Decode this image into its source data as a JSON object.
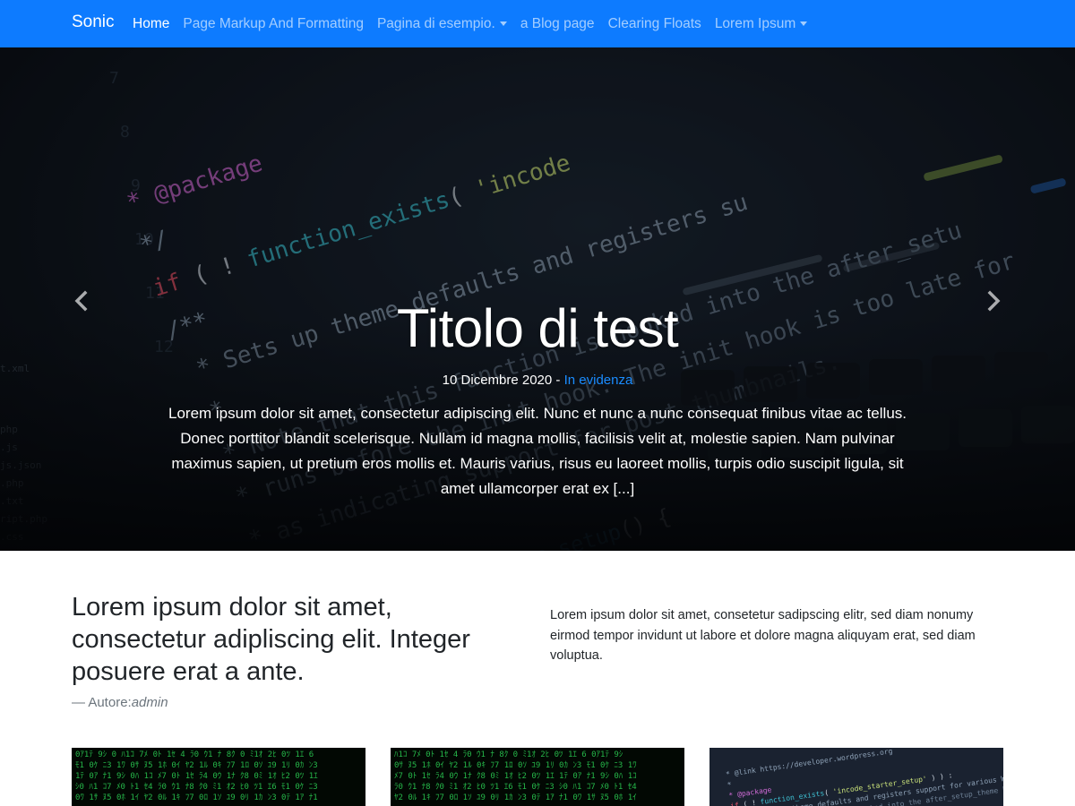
{
  "navbar": {
    "brand": "Sonic",
    "items": [
      {
        "label": "Home",
        "active": true,
        "dropdown": false
      },
      {
        "label": "Page Markup And Formatting",
        "active": false,
        "dropdown": false
      },
      {
        "label": "Pagina di esempio.",
        "active": false,
        "dropdown": true
      },
      {
        "label": "a Blog page",
        "active": false,
        "dropdown": false
      },
      {
        "label": "Clearing Floats",
        "active": false,
        "dropdown": false
      },
      {
        "label": "Lorem Ipsum",
        "active": false,
        "dropdown": true
      }
    ],
    "background": "#0d7bff"
  },
  "hero": {
    "title": "Titolo di test",
    "date": "10 Dicembre 2020",
    "separator": " - ",
    "category": "In evidenza",
    "excerpt": "Lorem ipsum dolor sit amet, consectetur adipiscing elit. Nunc et nunc a nunc consequat finibus vitae ac tellus. Donec porttitor blandit scelerisque. Nullam id magna mollis, facilisis velit at, molestie sapien. Nam pulvinar maximus sapien, ut pretium eros mollis et. Mauris varius, risus eu laoreet mollis, turpis odio suscipit ligula, sit amet ullamcorper erat ex [...]",
    "prev_icon": "chevron-left-icon",
    "next_icon": "chevron-right-icon"
  },
  "intro": {
    "heading": "Lorem ipsum dolor sit amet, consectetur adipliscing elit. Integer posuere erat a ante.",
    "byline_prefix": "— Autore:",
    "author": "admin",
    "text": "Lorem ipsum dolor sit amet, consetetur sadipscing elitr, sed diam nonumy eirmod tempor invidunt ut labore et dolore magna aliquyam erat, sed diam voluptua."
  },
  "cards": [
    {
      "image": "matrix-code-image"
    },
    {
      "image": "matrix-code-image"
    },
    {
      "image": "code-editor-image"
    }
  ],
  "colors": {
    "link": "#1a8cff",
    "muted": "#6c757d",
    "text": "#212529"
  }
}
